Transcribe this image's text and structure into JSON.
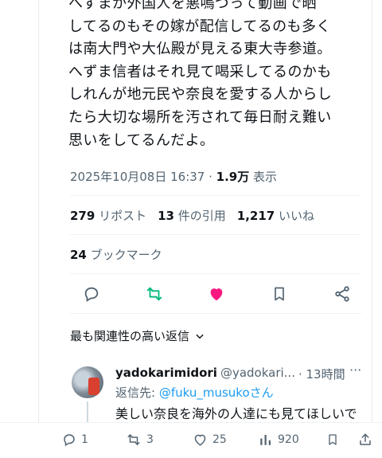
{
  "tweet": {
    "lines": [
      "へずまが外国人を悪嗚づって動画で晒",
      "してるのもその嫁が配信してるのも多く",
      "は南大門や大仏殿が見える東大寺参道。",
      "へずま信者はそれ見て喝采してるのかも",
      "しれんが地元民や奈良を愛する人からし",
      "たら大切な場所を汚されて毎日耐え難い",
      "思いをしてるんだよ。"
    ],
    "timestamp": "2025年10月08日 16:37 · ",
    "views_count": "1.9万",
    "views_label": " 表示"
  },
  "stats": {
    "reposts_count": "279",
    "reposts_label": "リポスト",
    "quotes_count": "13",
    "quotes_label": "件の引用",
    "likes_count": "1,217",
    "likes_label": "いいね",
    "bookmarks_count": "24",
    "bookmarks_label": "ブックマーク"
  },
  "sort": {
    "label": "最も関連性の高い返信"
  },
  "reply": {
    "name": "yadokarimidori",
    "handle": "@yadokari...",
    "time": "· 13時間",
    "more": "···",
    "reply_to_prefix": "返信先: ",
    "mention": "@fuku_musukoさん",
    "text": "美しい奈良を海外の人達にも見てほしいで"
  },
  "reply_actions": {
    "replies": "1",
    "reposts": "3",
    "likes": "25",
    "views": "920"
  },
  "colors": {
    "like_active": "#f91880",
    "repost": "#00ba7c",
    "link": "#1d9bf0",
    "muted": "#536471"
  }
}
